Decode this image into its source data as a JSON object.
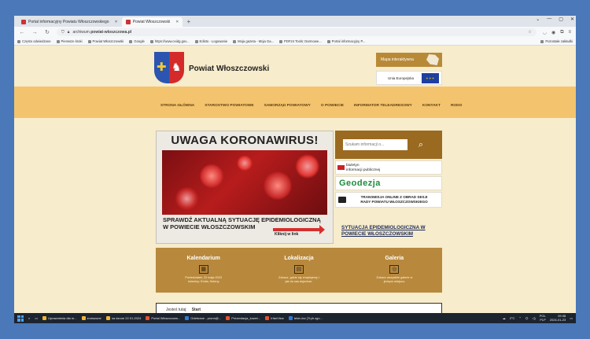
{
  "browser": {
    "tabs": [
      {
        "label": "Portal informacyjny Powiatu Włoszczowskiego",
        "active": false
      },
      {
        "label": "Powiat Włoszczowski",
        "active": true
      }
    ],
    "url_prefix": "archiwum.",
    "url_domain": "powiat-wloszczowa.pl",
    "bookmarks": [
      "Często odwiedzane",
      "Pierwsze kroki",
      "Powiat Włoszczowski",
      "Google",
      "https://www.ceidg.gov...",
      "Edisto - Logowanie",
      "Moja gazeta - Moja Ga...",
      "PDF24 Tools: Darmowe...",
      "Portal informacyjny P..."
    ],
    "other_bookmarks": "Pozostałe zakładki"
  },
  "site": {
    "title": "Powiat Włoszczowski",
    "map_label": "Mapa interaktywna",
    "eu_label": "Unia Europejska",
    "menu": [
      "STRONA GŁÓWNA",
      "STAROSTWO POWIATOWE",
      "SAMORZĄD POWIATOWY",
      "O POWIECIE",
      "INFORMATOR TELEADRESOWY",
      "KONTAKT",
      "RODO"
    ]
  },
  "banner": {
    "title": "UWAGA KORONAWIRUS!",
    "line1": "SPRAWDŹ AKTUALNĄ SYTUACJĘ EPIDEMIOLOGICZNĄ",
    "line2": "W POWIECIE WŁOSZCZOWSKIM",
    "cta": "Kliknij w link"
  },
  "sidebar": {
    "search_placeholder": "Szukam informacji o...",
    "bip_line1": "biuletyn",
    "bip_line2": "informacji publicznej",
    "geodezja": "Geodezja",
    "sesja_line1": "TRANSMISJA ONLINE Z OBRAD SESJI",
    "sesja_line2": "RADY POWIATU WŁOSZCZOWSKIEGO",
    "situation_link": "SYTUACJA EPIDEMIOLOGICZNA W POWIECIE WŁOSZCZOWSKIM"
  },
  "info": [
    {
      "heading": "Kalendarium",
      "line1": "Poniedziałek, 22 maja 2023",
      "line2": "Imieniny: Emila, Heleny"
    },
    {
      "heading": "Lokalizacja",
      "line1": "Zobacz, gdzie się znajdujemy i",
      "line2": "jak do nas dojechać."
    },
    {
      "heading": "Galeria",
      "line1": "Zobacz wszystkie galerie w",
      "line2": "jednym miejscu."
    }
  ],
  "breadcrumb": {
    "label": "Jesteś tutaj:",
    "current": "Start"
  },
  "taskbar": {
    "items": [
      "Uprawnienia dla m...",
      "zrzeszone",
      "na dzone 22.01.2024",
      "Portal Włoszczows...",
      "Odebrane - pronn@...",
      "Prezentacja_kowel...",
      "IrfanView",
      "telot.doc [Tryb zgo..."
    ],
    "temp": "2°C",
    "lang": "POL",
    "layout": "PLP",
    "time": "09:38",
    "date": "2024-01-23"
  }
}
